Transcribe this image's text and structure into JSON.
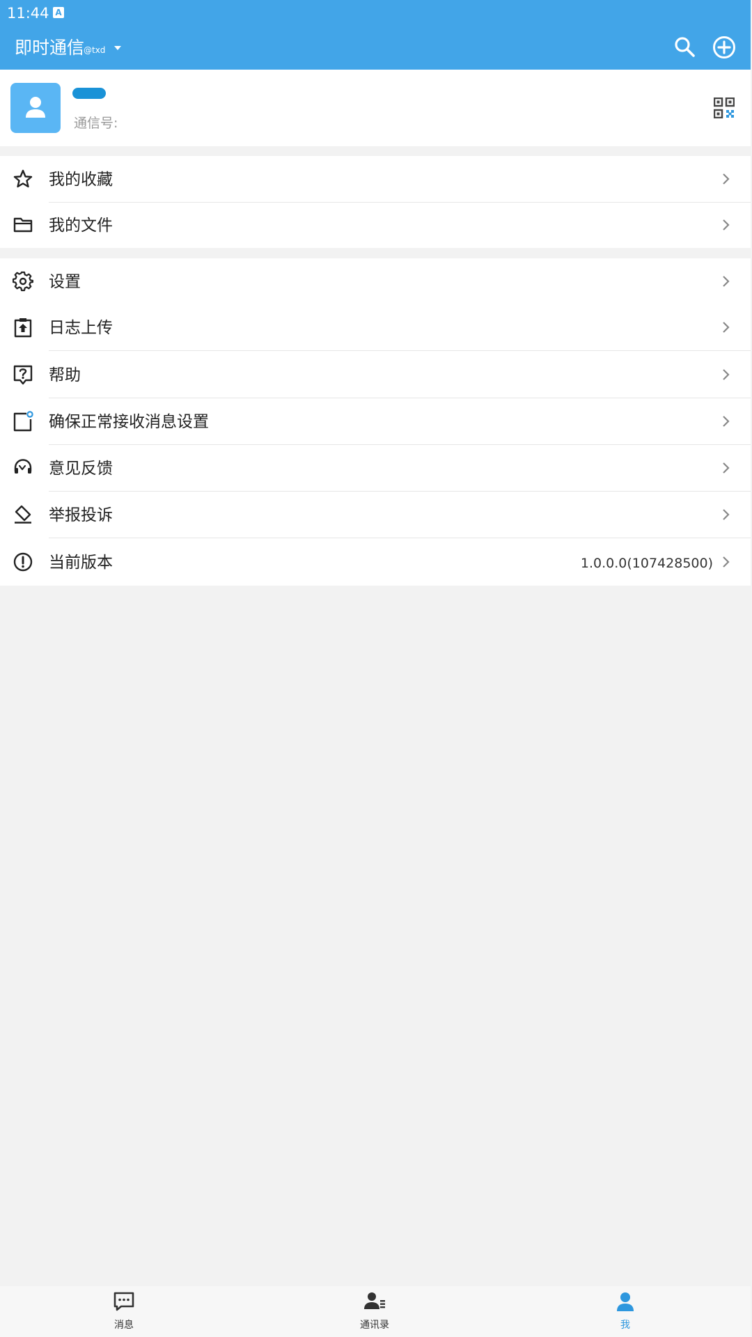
{
  "status_bar": {
    "time": "11:44",
    "notification_icon": "a-badge-icon"
  },
  "app_bar": {
    "title": "即时通信",
    "subtitle": "@txd",
    "actions": [
      "search-icon",
      "add-circle-icon"
    ]
  },
  "profile": {
    "id_label": "通信号:",
    "avatar_icon": "person-icon",
    "qr_icon": "qr-code-icon"
  },
  "menu_group_1": [
    {
      "label": "我的收藏",
      "icon": "star-icon"
    },
    {
      "label": "我的文件",
      "icon": "folder-icon"
    }
  ],
  "menu_group_2": [
    {
      "label": "设置",
      "icon": "gear-icon"
    },
    {
      "label": "日志上传",
      "icon": "upload-clipboard-icon"
    },
    {
      "label": "帮助",
      "icon": "help-bubble-icon"
    },
    {
      "label": "确保正常接收消息设置",
      "icon": "notification-square-icon"
    },
    {
      "label": "意见反馈",
      "icon": "headset-icon"
    },
    {
      "label": "举报投诉",
      "icon": "report-eraser-icon"
    },
    {
      "label": "当前版本",
      "icon": "info-circle-icon",
      "value": "1.0.0.0(107428500)"
    }
  ],
  "bottom_nav": [
    {
      "label": "消息",
      "icon": "chat-icon",
      "active": false
    },
    {
      "label": "通讯录",
      "icon": "contacts-icon",
      "active": false
    },
    {
      "label": "我",
      "icon": "person-icon",
      "active": true
    }
  ],
  "colors": {
    "primary": "#42a5e8",
    "active_tab": "#2e97de",
    "background": "#f2f2f2"
  }
}
